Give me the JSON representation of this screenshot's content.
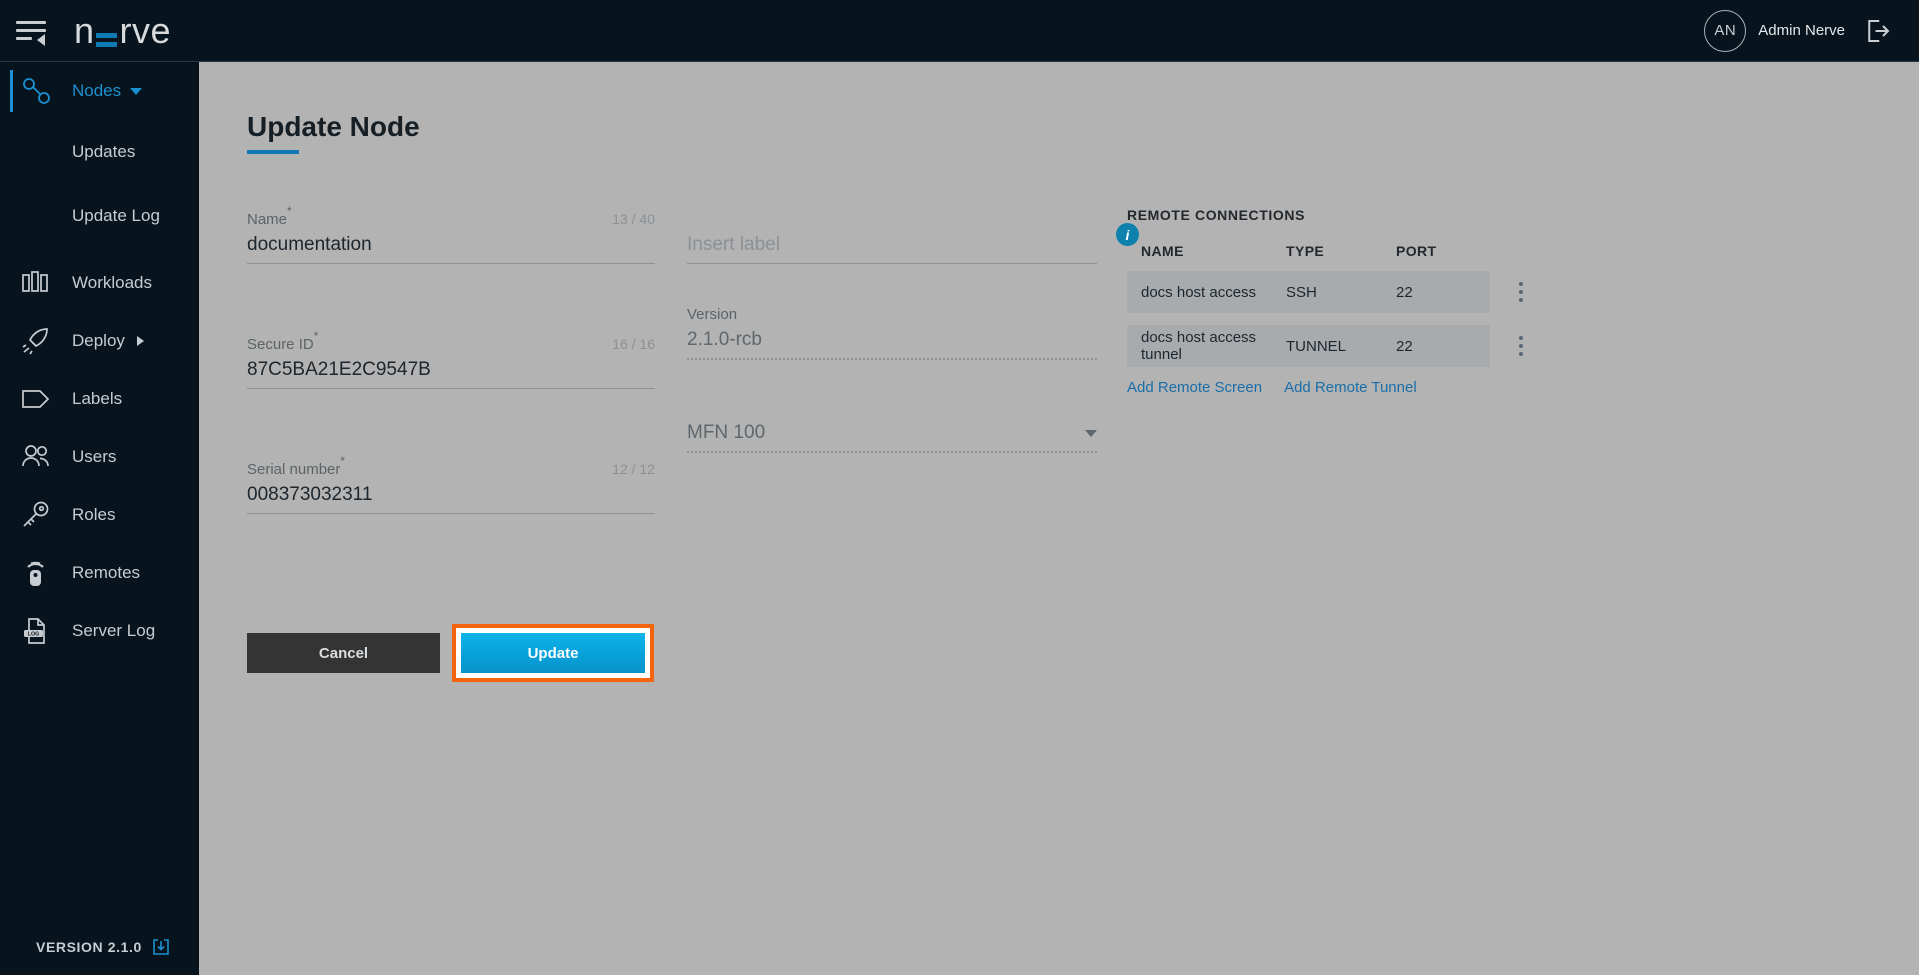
{
  "header": {
    "logo_text": "nerve",
    "menu_icon": "hamburger-collapse-icon",
    "user_initials": "AN",
    "user_name": "Admin Nerve",
    "logout_icon": "logout-icon"
  },
  "sidebar": {
    "items": [
      {
        "label": "Nodes",
        "icon": "nodes-icon",
        "active": true,
        "caret": "down"
      },
      {
        "label": "Updates",
        "icon": "",
        "sub": true
      },
      {
        "label": "Update Log",
        "icon": "",
        "sub": true
      },
      {
        "label": "Workloads",
        "icon": "workloads-icon"
      },
      {
        "label": "Deploy",
        "icon": "rocket-icon",
        "caret": "right"
      },
      {
        "label": "Labels",
        "icon": "label-tag-icon"
      },
      {
        "label": "Users",
        "icon": "users-icon"
      },
      {
        "label": "Roles",
        "icon": "key-icon"
      },
      {
        "label": "Remotes",
        "icon": "remote-control-icon"
      },
      {
        "label": "Server Log",
        "icon": "server-log-icon"
      }
    ],
    "version_label": "VERSION 2.1.0",
    "download_icon": "download-icon"
  },
  "main": {
    "title": "Update Node",
    "fields": {
      "name": {
        "label": "Name",
        "required": "*",
        "counter": "13 / 40",
        "value": "documentation"
      },
      "secure_id": {
        "label": "Secure ID",
        "required": "*",
        "counter": "16 / 16",
        "value": "87C5BA21E2C9547B"
      },
      "serial_number": {
        "label": "Serial number",
        "required": "*",
        "counter": "12 / 12",
        "value": "008373032311"
      },
      "label_input": {
        "placeholder": "Insert label",
        "value": "",
        "info_icon": "info-icon"
      },
      "version": {
        "label": "Version",
        "value": "2.1.0-rcb"
      },
      "model": {
        "value": "MFN 100",
        "caret_icon": "chevron-down-icon"
      }
    },
    "remote_connections": {
      "title": "REMOTE CONNECTIONS",
      "columns": [
        "NAME",
        "TYPE",
        "PORT"
      ],
      "rows": [
        {
          "name": "docs host access",
          "type": "SSH",
          "port": "22"
        },
        {
          "name": "docs host access tunnel",
          "type": "TUNNEL",
          "port": "22"
        }
      ],
      "links": [
        "Add Remote Screen",
        "Add Remote Tunnel"
      ]
    },
    "buttons": {
      "cancel": "Cancel",
      "update": "Update"
    }
  },
  "colors": {
    "accent_blue": "#0e79b2",
    "dark_navy": "#08141d",
    "page_bg": "#b3b3b3",
    "highlight_orange": "#f4640c",
    "link_blue": "#1a6ea8"
  }
}
